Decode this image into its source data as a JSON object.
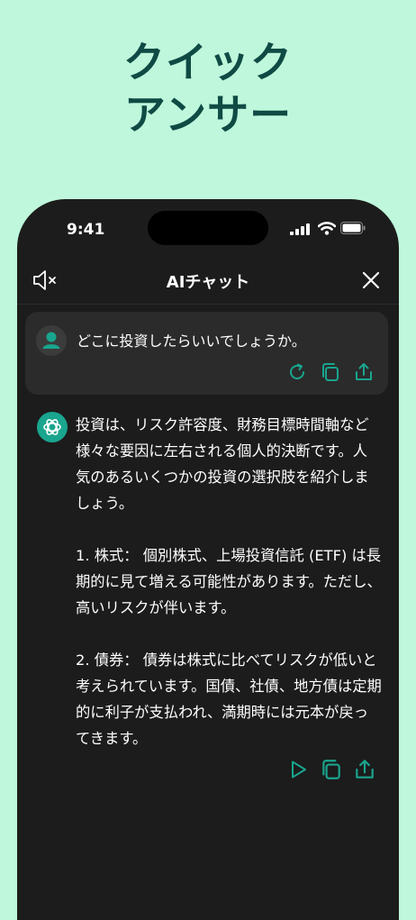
{
  "promo": {
    "headline_line1": "クイック",
    "headline_line2": "アンサー"
  },
  "status_bar": {
    "time": "9:41"
  },
  "nav": {
    "title": "AIチャット",
    "left_icon": "speaker-mute-icon",
    "right_icon": "close-icon"
  },
  "user_message": {
    "avatar_icon": "user-icon",
    "text": "どこに投資したらいいでしょうか。",
    "actions": [
      "refresh-icon",
      "copy-icon",
      "share-icon"
    ]
  },
  "bot_message": {
    "avatar_icon": "ai-logo-icon",
    "paragraphs": [
      "投資は、リスク許容度、財務目標時間軸など様々な要因に左右される個人的決断です。人気のあるいくつかの投資の選択肢を紹介しましょう。",
      "1. 株式： 個別株式、上場投資信託 (ETF) は長期的に見て増える可能性があります。ただし、高いリスクが伴います。",
      "2. 債券： 債券は株式に比べてリスクが低いと考えられています。国債、社債、地方債は定期的に利子が支払われ、満期時には元本が戻ってきます。"
    ],
    "actions": [
      "play-icon",
      "copy-icon",
      "share-icon"
    ]
  },
  "colors": {
    "background": "#bff7dc",
    "headline": "#0f4a44",
    "phone": "#1c1c1c",
    "accent": "#19a58e"
  }
}
